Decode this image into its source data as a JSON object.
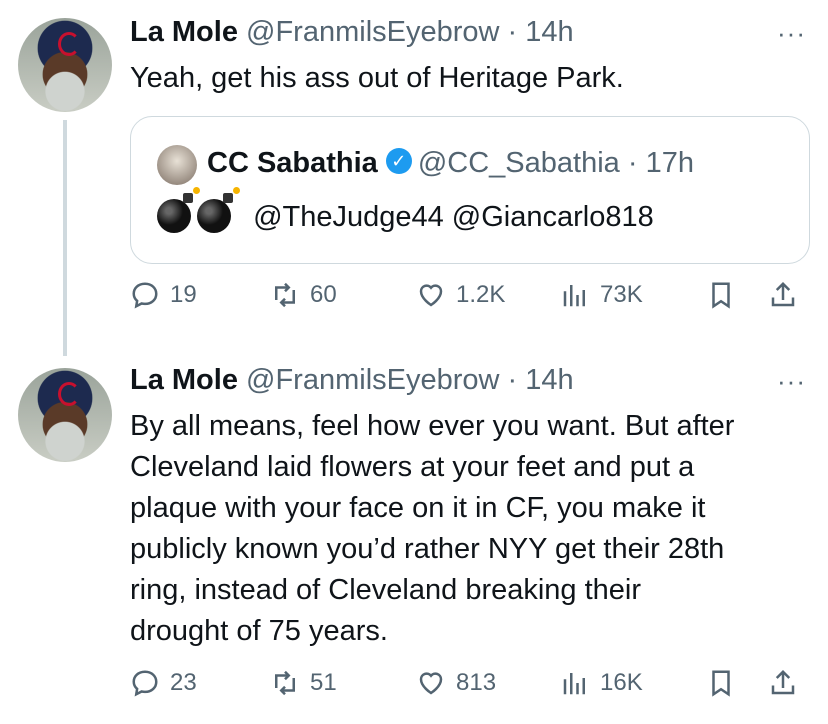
{
  "tweet1": {
    "name": "La Mole",
    "handle": "@FranmilsEyebrow",
    "sep": " · ",
    "time": "14h",
    "more": "···",
    "text": "Yeah, get his ass out of Heritage Park.",
    "quote": {
      "name": "CC Sabathia",
      "verified_mark": "✓",
      "handle": "@CC_Sabathia",
      "sep": " · ",
      "time": "17h",
      "text": "@TheJudge44 @Giancarlo818"
    },
    "actions": {
      "replies": "19",
      "retweets": "60",
      "likes": "1.2K",
      "views": "73K"
    }
  },
  "tweet2": {
    "name": "La Mole",
    "handle": "@FranmilsEyebrow",
    "sep": " · ",
    "time": "14h",
    "more": "···",
    "lines": [
      "By all means, feel how ever you want. But after",
      "Cleveland laid flowers at your feet and put a",
      "plaque with your face on it in CF, you make it",
      "publicly known you’d rather NYY get their 28th",
      "ring, instead of Cleveland breaking their",
      "drought of 75 years."
    ],
    "actions": {
      "replies": "23",
      "retweets": "51",
      "likes": "813",
      "views": "16K"
    }
  },
  "icons": [
    "reply-icon",
    "retweet-icon",
    "like-icon",
    "views-icon",
    "bookmark-icon",
    "share-icon"
  ],
  "colors": {
    "text": "#0f1419",
    "secondary": "#536471",
    "verified": "#1d9bf0",
    "border": "#cfd9de"
  }
}
